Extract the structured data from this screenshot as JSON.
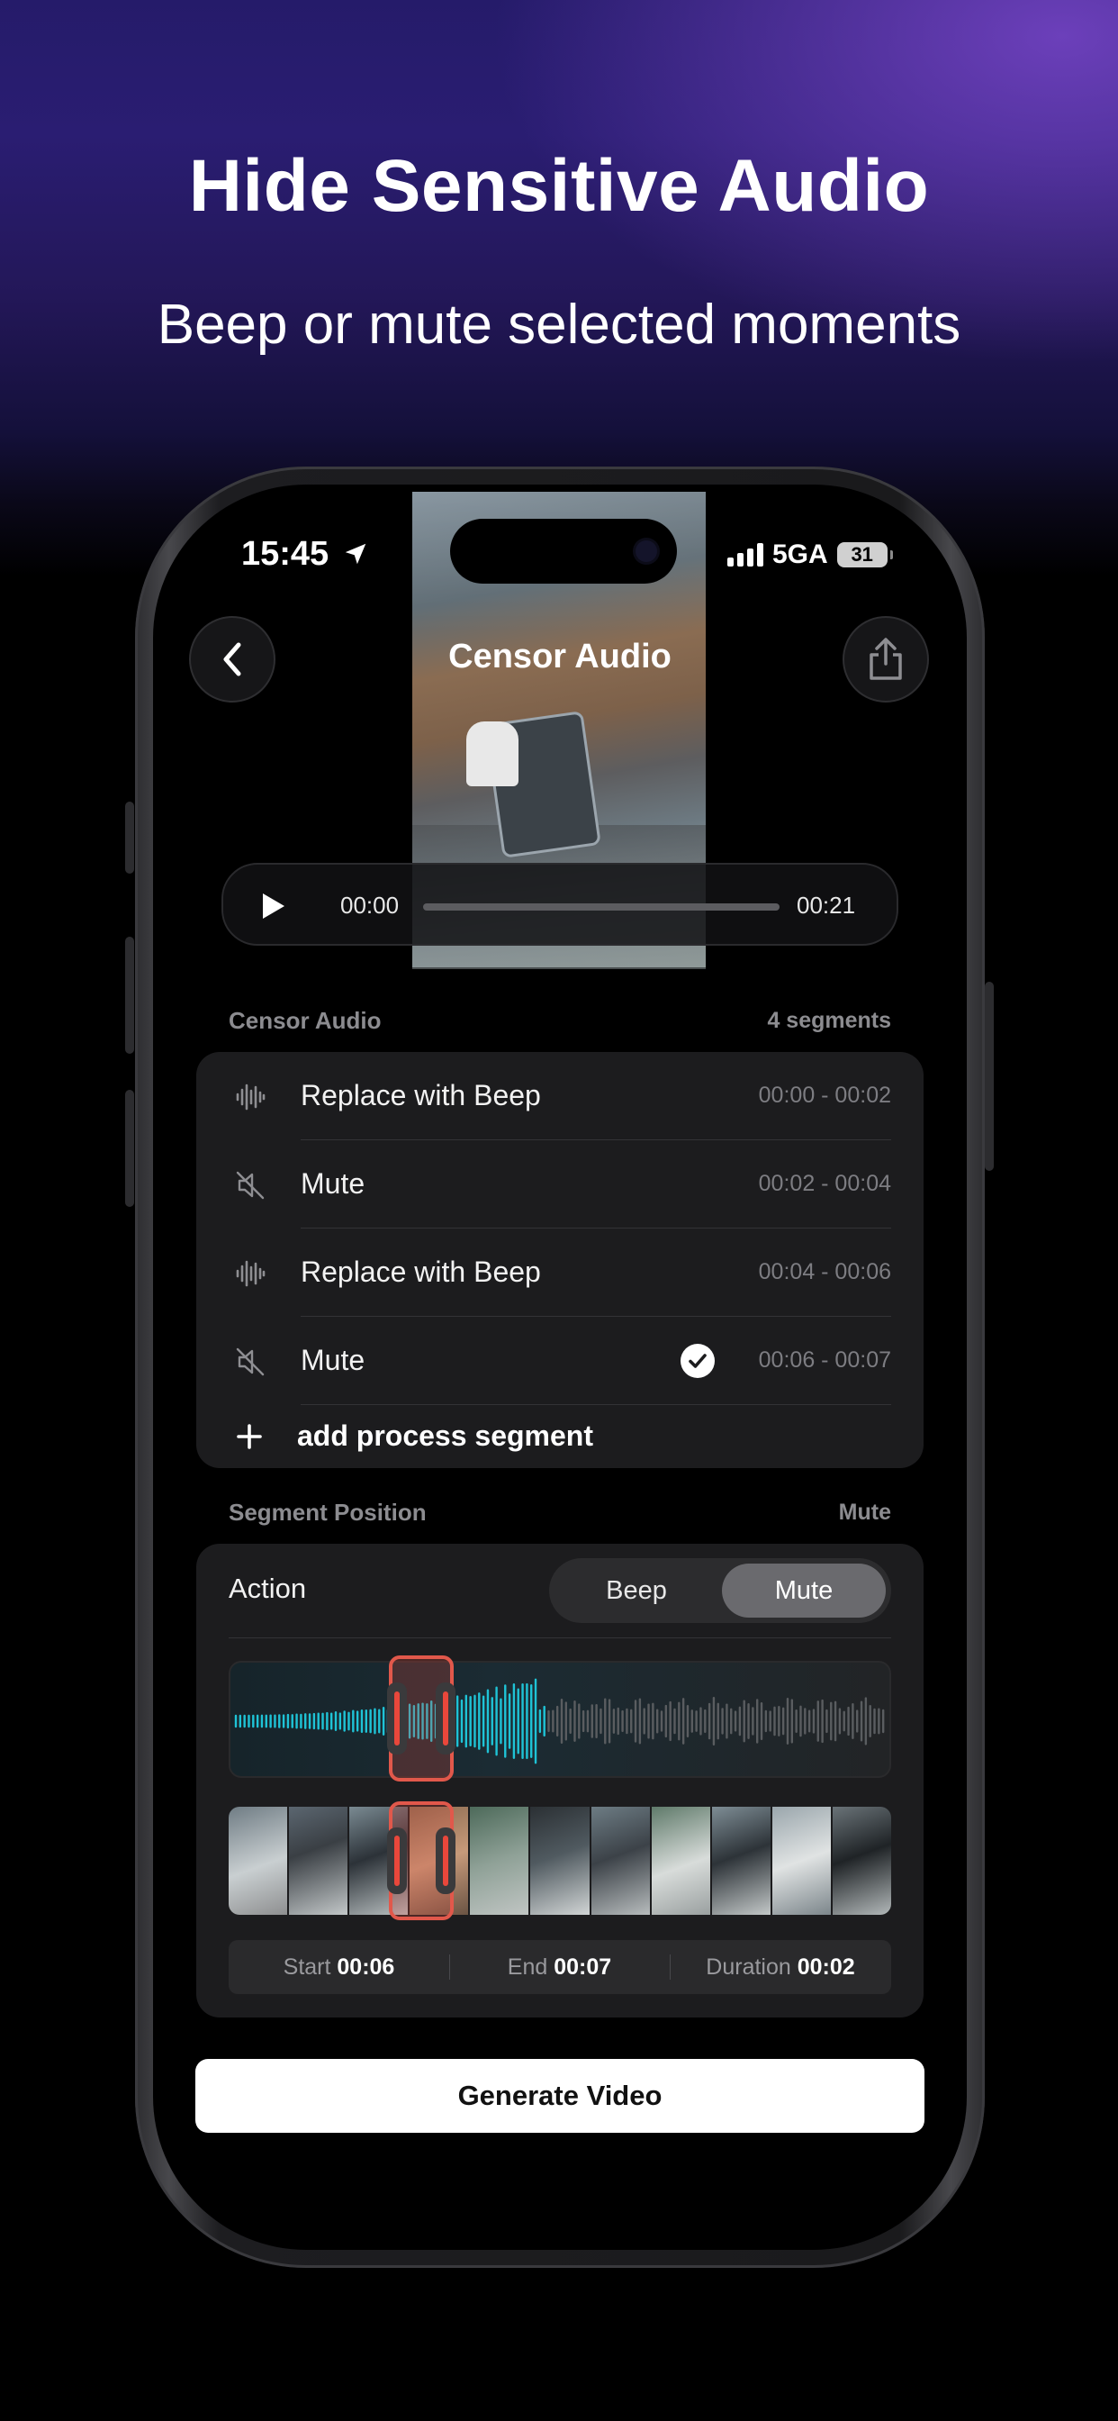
{
  "headline": "Hide Sensitive Audio",
  "subheadline": "Beep or mute selected moments",
  "status_bar": {
    "time": "15:45",
    "network": "5GA",
    "battery": "31"
  },
  "nav": {
    "title": "Censor Audio",
    "back_icon": "chevron-left-icon",
    "share_icon": "share-icon"
  },
  "player": {
    "start_time": "00:00",
    "end_time": "00:21",
    "progress": 0
  },
  "censor_section": {
    "label": "Censor Audio",
    "count": "4 segments",
    "segments": [
      {
        "label": "Replace with Beep",
        "range": "00:00 - 00:02",
        "icon": "waveform-icon",
        "selected": false
      },
      {
        "label": "Mute",
        "range": "00:02 - 00:04",
        "icon": "speaker-muted-icon",
        "selected": false
      },
      {
        "label": "Replace with Beep",
        "range": "00:04 - 00:06",
        "icon": "waveform-icon",
        "selected": false
      },
      {
        "label": "Mute",
        "range": "00:06 - 00:07",
        "icon": "speaker-muted-icon",
        "selected": true
      }
    ],
    "add_label": "add process segment"
  },
  "position_section": {
    "label": "Segment Position",
    "mode": "Mute",
    "action_label": "Action",
    "options": [
      "Beep",
      "Mute"
    ],
    "selected_option": "Mute",
    "start_label": "Start",
    "start_value": "00:06",
    "end_label": "End",
    "end_value": "00:07",
    "duration_label": "Duration",
    "duration_value": "00:02"
  },
  "generate_button": "Generate Video",
  "colors": {
    "accent_cyan": "#1fc3d6",
    "handle_red": "#e1584b",
    "card_bg": "#1c1c1e",
    "bg_purple": "#2a1d72"
  }
}
